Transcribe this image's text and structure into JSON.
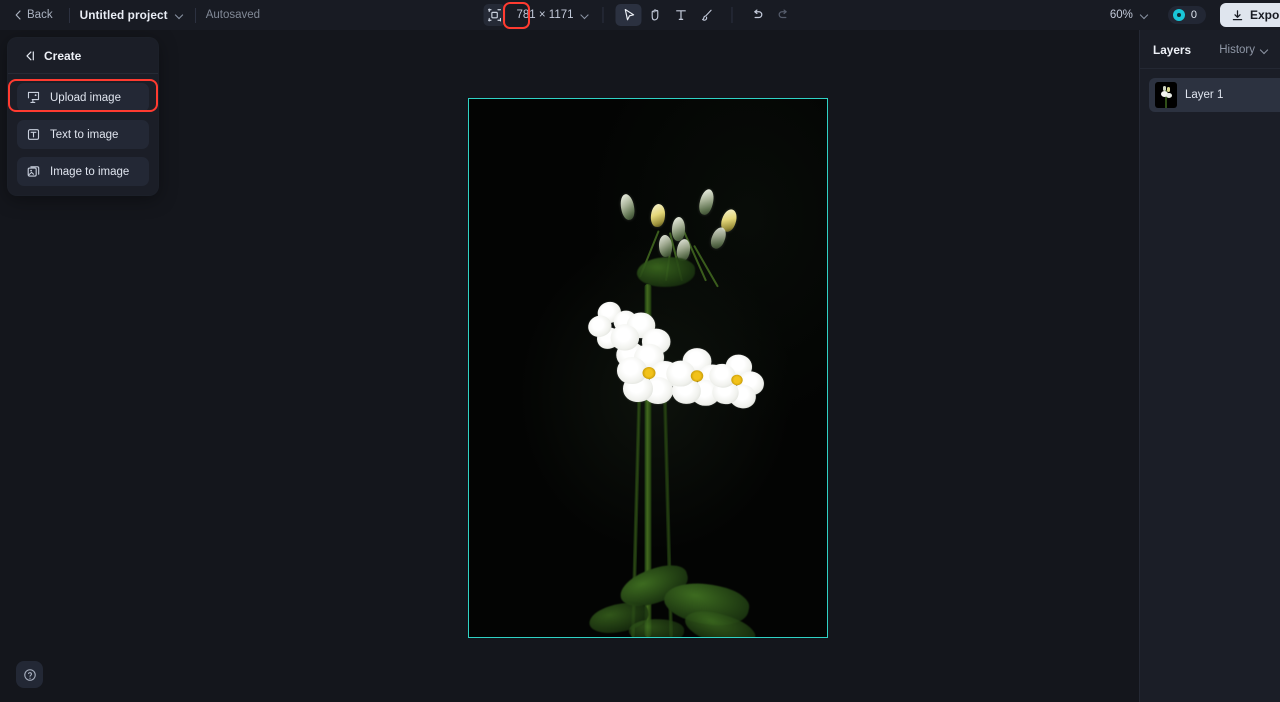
{
  "topbar": {
    "back_label": "Back",
    "project_title": "Untitled project",
    "autosaved_label": "Autosaved",
    "frame_tool_name": "frame-resize-icon",
    "dimensions": "781 × 1171",
    "tools": [
      {
        "name": "select-tool",
        "icon": "cursor-icon",
        "active": true
      },
      {
        "name": "hand-tool",
        "icon": "hand-icon",
        "active": false
      },
      {
        "name": "text-tool",
        "icon": "text-icon",
        "active": false
      },
      {
        "name": "brush-tool",
        "icon": "brush-icon",
        "active": false
      }
    ],
    "undo_label": "undo-icon",
    "redo_label": "redo-icon",
    "zoom_level": "60%",
    "credits_count": "0",
    "export_label": "Export",
    "accent_teal": "#19c6d8",
    "export_bg": "#dfe5ee"
  },
  "create_panel": {
    "header_label": "Create",
    "collapse_icon": "collapse-panel-icon",
    "items": [
      {
        "label": "Upload image",
        "icon": "upload-image-icon",
        "highlighted": true
      },
      {
        "label": "Text to image",
        "icon": "text-to-image-icon",
        "highlighted": false
      },
      {
        "label": "Image to image",
        "icon": "image-to-image-icon",
        "highlighted": false
      }
    ],
    "highlight_color": "#ff3b30"
  },
  "canvas": {
    "selection_color": "#2fd2c5",
    "background": "#14161c",
    "artboard_background": "#000000",
    "image_description": "White primrose flowers with yellow centers on a black background"
  },
  "layers_panel": {
    "tab_active": "Layers",
    "tab_inactive": "History",
    "layers": [
      {
        "name": "Layer 1",
        "selected": true
      }
    ]
  },
  "help": {
    "icon": "help-circle-icon"
  }
}
